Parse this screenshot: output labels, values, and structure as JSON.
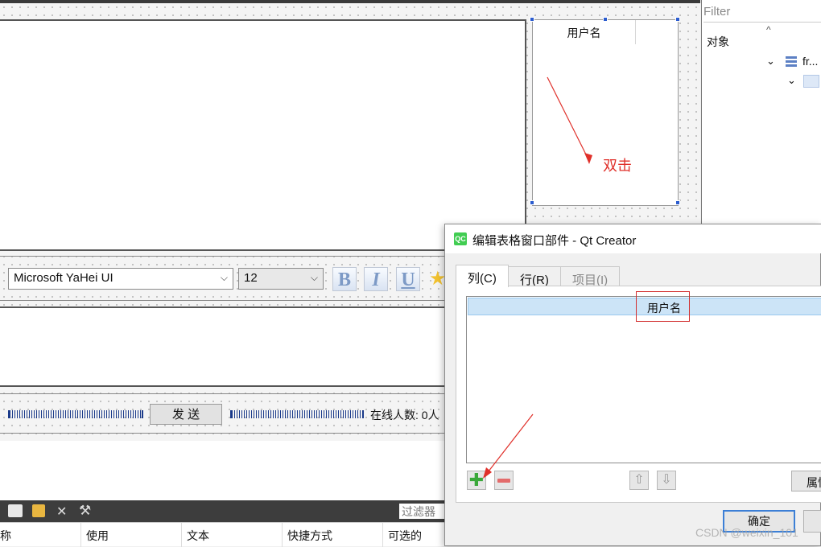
{
  "filter": {
    "placeholder": "Filter"
  },
  "object_panel": {
    "header": "对象",
    "items": [
      {
        "label": "fr..."
      }
    ]
  },
  "table_widget": {
    "header_label": "用户名"
  },
  "annotation": {
    "text": "双击",
    "color": "#e0302a"
  },
  "toolbar": {
    "font_combo": "Microsoft YaHei UI",
    "size_combo": "12",
    "bold": "B",
    "italic": "I",
    "underline": "U"
  },
  "send_row": {
    "send_button": "发 送",
    "online_label": "在线人数: 0人"
  },
  "action_editor": {
    "filter_placeholder": "过滤器",
    "columns": [
      "称",
      "使用",
      "文本",
      "快捷方式",
      "可选的"
    ]
  },
  "dialog": {
    "title": "编辑表格窗口部件 - Qt Creator",
    "app_icon": "QC",
    "tabs": [
      "列(C)",
      "行(R)",
      "项目(I)"
    ],
    "column_item": "用户名",
    "properties_button": "属性",
    "ok_button": "确定"
  },
  "watermark": "CSDN @weixin_101",
  "colors": {
    "selection": "#cce4f7",
    "highlight_box": "#d23030",
    "handle": "#2b5ccf",
    "ok_border": "#3c7fd6"
  }
}
